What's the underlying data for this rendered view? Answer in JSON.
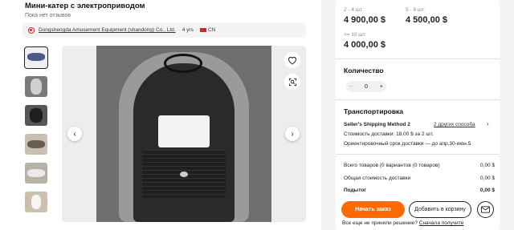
{
  "product": {
    "title": "Мини-катер с электроприводом",
    "reviews": "Пока нет отзывов"
  },
  "supplier": {
    "name": "Dongshengda Amusement Equipment (shandong) Co., Ltd.",
    "years": "4 yrs",
    "country": "CN"
  },
  "thumbnails": [
    {
      "icon": "boat-thumb-1"
    },
    {
      "icon": "boat-thumb-2"
    },
    {
      "icon": "boat-thumb-3"
    },
    {
      "icon": "boat-thumb-4"
    },
    {
      "icon": "boat-thumb-5"
    },
    {
      "icon": "boat-thumb-6"
    }
  ],
  "price_tiers": [
    {
      "qty": "2 - 4 шт.",
      "price": "4 900,00 $"
    },
    {
      "qty": "5 - 9 шт.",
      "price": "4 500,00 $"
    },
    {
      "qty": ">= 10 шт.",
      "price": "4 000,00 $"
    }
  ],
  "quantity": {
    "label": "Количество",
    "minus": "−",
    "value": "0",
    "plus": "+"
  },
  "shipping": {
    "title": "Транспортировка",
    "method": "Seller's Shipping Method 2",
    "other_methods": "2 других способа",
    "cost": "Стоимость доставки: 18,00 $ за 2 шт.",
    "eta": "Ориентировочный срок доставки — до апр.30-июн.5"
  },
  "summary": {
    "total_items_label": "Всего товаров (0 вариантов (0 товаров)",
    "total_items_value": "0,00 $",
    "shipping_total_label": "Общая стоимость доставки",
    "shipping_total_value": "0,00 $",
    "subtotal_label": "Подытог",
    "subtotal_value": "0,00 $"
  },
  "actions": {
    "order": "Начать заказ",
    "cart": "Добавить в корзину"
  },
  "footer": {
    "question": "Все еще не приняли решение?",
    "sample": "Сначала получите"
  },
  "colors": {
    "accent": "#ff6a00"
  }
}
